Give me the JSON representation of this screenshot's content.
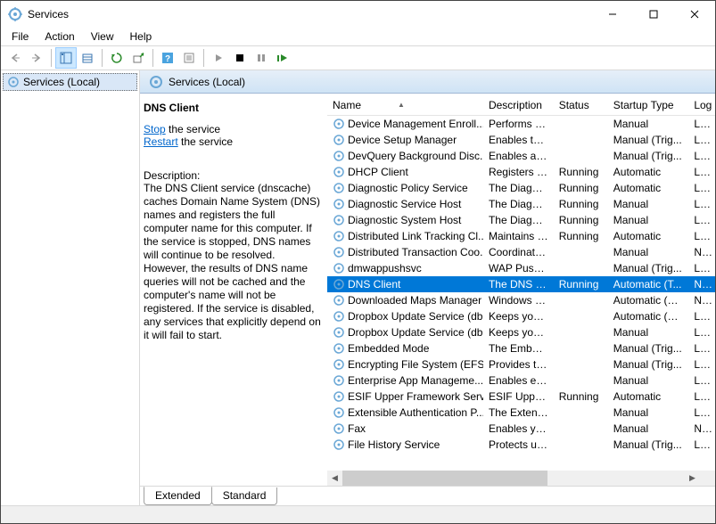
{
  "window": {
    "title": "Services"
  },
  "menu": {
    "file": "File",
    "action": "Action",
    "view": "View",
    "help": "Help"
  },
  "tree": {
    "root": "Services (Local)"
  },
  "header": {
    "title": "Services (Local)"
  },
  "detail": {
    "name": "DNS Client",
    "stop_pre": "Stop",
    "stop_post": " the service",
    "restart_pre": "Restart",
    "restart_post": " the service",
    "desclabel": "Description:",
    "description": "The DNS Client service (dnscache) caches Domain Name System (DNS) names and registers the full computer name for this computer. If the service is stopped, DNS names will continue to be resolved. However, the results of DNS name queries will not be cached and the computer's name will not be registered. If the service is disabled, any services that explicitly depend on it will fail to start."
  },
  "columns": {
    "name": "Name",
    "desc": "Description",
    "status": "Status",
    "startup": "Startup Type",
    "logon": "Log"
  },
  "services": [
    {
      "name": "Device Management Enroll...",
      "desc": "Performs D...",
      "status": "",
      "startup": "Manual",
      "logon": "Loc",
      "sel": false
    },
    {
      "name": "Device Setup Manager",
      "desc": "Enables the ...",
      "status": "",
      "startup": "Manual (Trig...",
      "logon": "Loc",
      "sel": false
    },
    {
      "name": "DevQuery Background Disc...",
      "desc": "Enables app...",
      "status": "",
      "startup": "Manual (Trig...",
      "logon": "Loc",
      "sel": false
    },
    {
      "name": "DHCP Client",
      "desc": "Registers an...",
      "status": "Running",
      "startup": "Automatic",
      "logon": "Loc",
      "sel": false
    },
    {
      "name": "Diagnostic Policy Service",
      "desc": "The Diagno...",
      "status": "Running",
      "startup": "Automatic",
      "logon": "Loc",
      "sel": false
    },
    {
      "name": "Diagnostic Service Host",
      "desc": "The Diagno...",
      "status": "Running",
      "startup": "Manual",
      "logon": "Loc",
      "sel": false
    },
    {
      "name": "Diagnostic System Host",
      "desc": "The Diagno...",
      "status": "Running",
      "startup": "Manual",
      "logon": "Loc",
      "sel": false
    },
    {
      "name": "Distributed Link Tracking Cl...",
      "desc": "Maintains li...",
      "status": "Running",
      "startup": "Automatic",
      "logon": "Loc",
      "sel": false
    },
    {
      "name": "Distributed Transaction Coo...",
      "desc": "Coordinates...",
      "status": "",
      "startup": "Manual",
      "logon": "Net",
      "sel": false
    },
    {
      "name": "dmwappushsvc",
      "desc": "WAP Push ...",
      "status": "",
      "startup": "Manual (Trig...",
      "logon": "Loc",
      "sel": false
    },
    {
      "name": "DNS Client",
      "desc": "The DNS Cli...",
      "status": "Running",
      "startup": "Automatic (T...",
      "logon": "Net",
      "sel": true
    },
    {
      "name": "Downloaded Maps Manager",
      "desc": "Windows se...",
      "status": "",
      "startup": "Automatic (D...",
      "logon": "Net",
      "sel": false
    },
    {
      "name": "Dropbox Update Service (db...",
      "desc": "Keeps your ...",
      "status": "",
      "startup": "Automatic (D...",
      "logon": "Loc",
      "sel": false
    },
    {
      "name": "Dropbox Update Service (db...",
      "desc": "Keeps your ...",
      "status": "",
      "startup": "Manual",
      "logon": "Loc",
      "sel": false
    },
    {
      "name": "Embedded Mode",
      "desc": "The Embed...",
      "status": "",
      "startup": "Manual (Trig...",
      "logon": "Loc",
      "sel": false
    },
    {
      "name": "Encrypting File System (EFS)",
      "desc": "Provides th...",
      "status": "",
      "startup": "Manual (Trig...",
      "logon": "Loc",
      "sel": false
    },
    {
      "name": "Enterprise App Manageme...",
      "desc": "Enables ent...",
      "status": "",
      "startup": "Manual",
      "logon": "Loc",
      "sel": false
    },
    {
      "name": "ESIF Upper Framework Servi...",
      "desc": "ESIF Upper ...",
      "status": "Running",
      "startup": "Automatic",
      "logon": "Loc",
      "sel": false
    },
    {
      "name": "Extensible Authentication P...",
      "desc": "The Extensi...",
      "status": "",
      "startup": "Manual",
      "logon": "Loc",
      "sel": false
    },
    {
      "name": "Fax",
      "desc": "Enables you...",
      "status": "",
      "startup": "Manual",
      "logon": "Net",
      "sel": false
    },
    {
      "name": "File History Service",
      "desc": "Protects use...",
      "status": "",
      "startup": "Manual (Trig...",
      "logon": "Loc",
      "sel": false
    }
  ],
  "tabs": {
    "extended": "Extended",
    "standard": "Standard"
  }
}
